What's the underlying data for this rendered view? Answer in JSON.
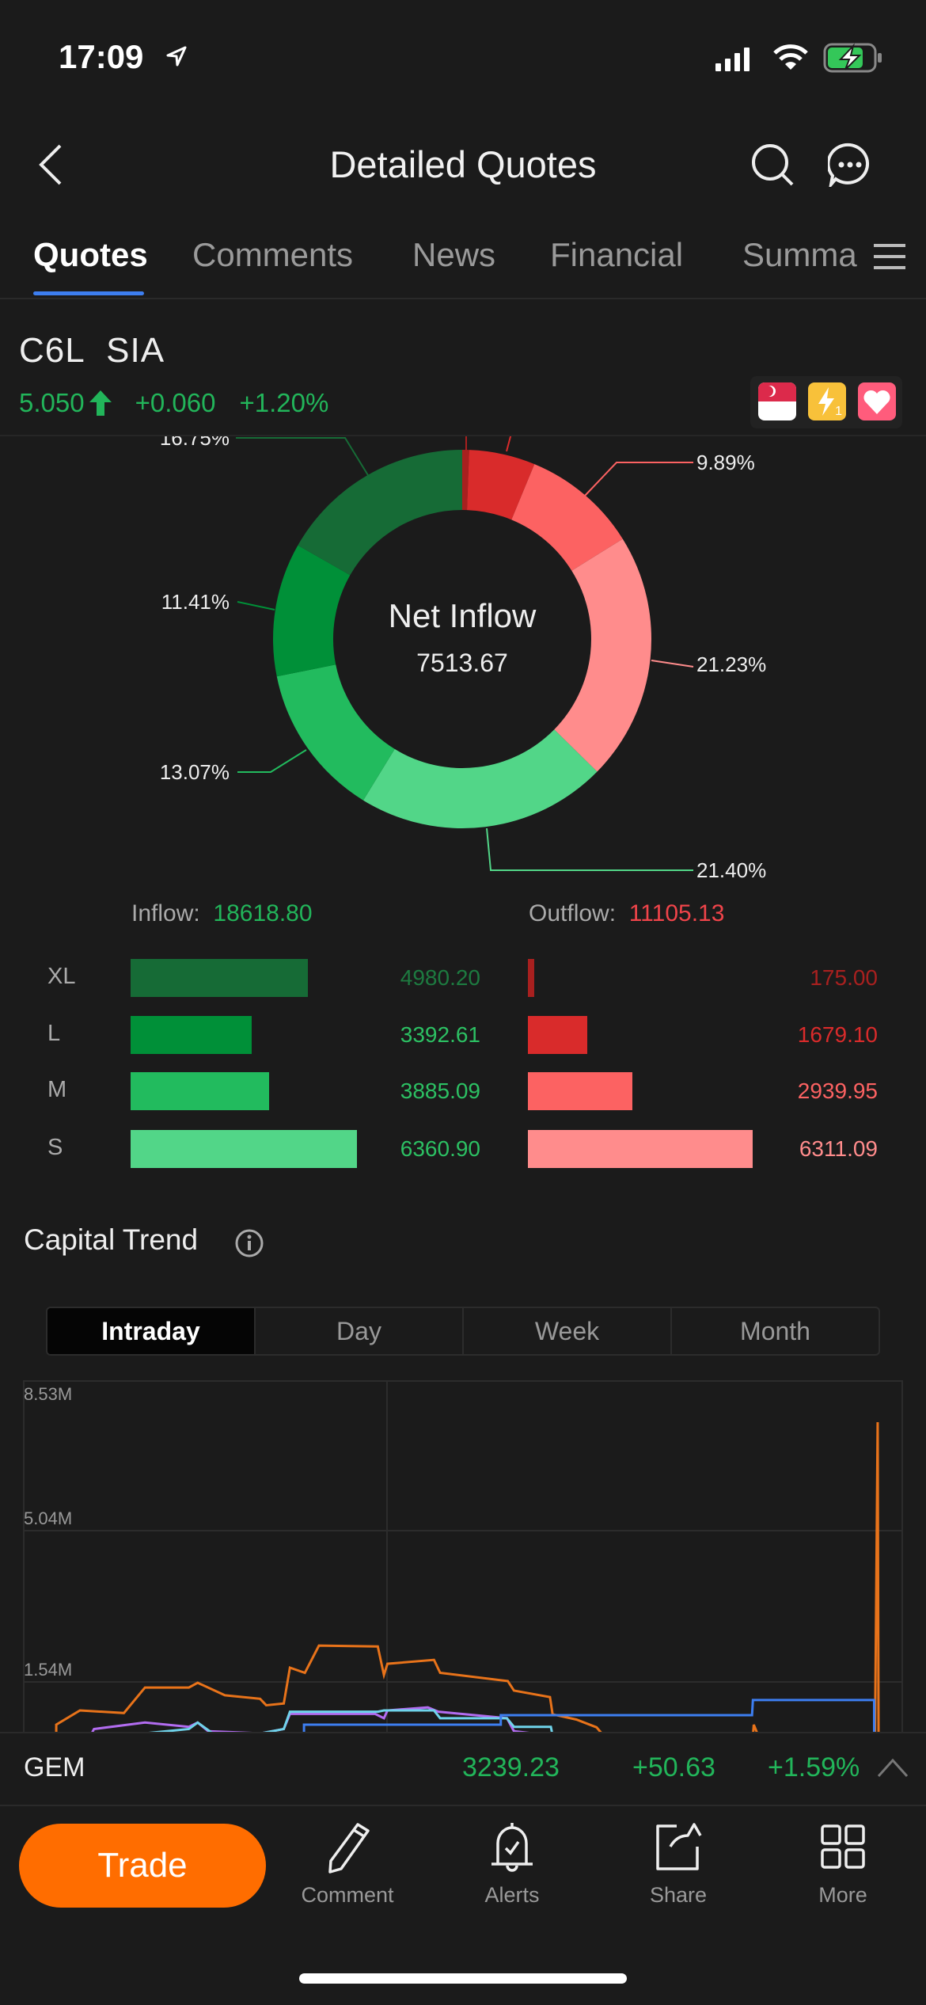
{
  "status_bar": {
    "time": "17:09",
    "battery_color": "#34c759"
  },
  "nav": {
    "title": "Detailed Quotes"
  },
  "tabs": [
    {
      "label": "Quotes",
      "active": true
    },
    {
      "label": "Comments"
    },
    {
      "label": "News"
    },
    {
      "label": "Financial"
    },
    {
      "label": "Summa"
    }
  ],
  "stock": {
    "symbol": "C6L",
    "name": "SIA",
    "price": "5.050",
    "change": "+0.060",
    "change_pct": "+1.20%",
    "badges": [
      "singapore-flag-icon",
      "lightning-icon",
      "heart-icon"
    ],
    "lightning_count": "1"
  },
  "donut": {
    "center_label": "Net Inflow",
    "center_value": "7513.67",
    "visible_labels": {
      "xl_in": "16.75%",
      "m_out": "9.89%",
      "s_out": "21.23%",
      "s_in": "21.40%",
      "m_in": "13.07%",
      "l_in": "11.41%"
    }
  },
  "flows": {
    "inflow_label": "Inflow:",
    "inflow_total": "18618.80",
    "outflow_label": "Outflow:",
    "outflow_total": "11105.13",
    "rows": [
      {
        "label": "XL",
        "inflow": "4980.20",
        "outflow": "175.00",
        "in_color": "#166b36",
        "out_color": "#a8201f"
      },
      {
        "label": "L",
        "inflow": "3392.61",
        "outflow": "1679.10",
        "in_color": "#009038",
        "out_color": "#d92b2b"
      },
      {
        "label": "M",
        "inflow": "3885.09",
        "outflow": "2939.95",
        "in_color": "#22bb5e",
        "out_color": "#fc6262"
      },
      {
        "label": "S",
        "inflow": "6360.90",
        "outflow": "6311.09",
        "in_color": "#52d688",
        "out_color": "#ff8c8c"
      }
    ]
  },
  "capital_trend": {
    "title": "Capital Trend",
    "periods": [
      {
        "label": "Intraday",
        "active": true
      },
      {
        "label": "Day"
      },
      {
        "label": "Week"
      },
      {
        "label": "Month"
      }
    ]
  },
  "chart_data": {
    "type": "line",
    "y_tick_labels": [
      "8.53M",
      "5.04M",
      "1.54M"
    ],
    "ylim": [
      0,
      8.53
    ],
    "grid": true,
    "x_unit": "percent of session elapsed",
    "series": [
      {
        "color": "#e8731a",
        "points": [
          [
            3.7,
            0.3
          ],
          [
            3.7,
            0.55
          ],
          [
            6.4,
            0.88
          ],
          [
            11.4,
            0.82
          ],
          [
            13.8,
            1.41
          ],
          [
            18.8,
            1.41
          ],
          [
            19.8,
            1.52
          ],
          [
            22.9,
            1.23
          ],
          [
            26.9,
            1.15
          ],
          [
            27.6,
            1.0
          ],
          [
            29.6,
            1.04
          ],
          [
            30.3,
            1.87
          ],
          [
            32,
            1.75
          ],
          [
            33.6,
            2.38
          ],
          [
            40.3,
            2.36
          ],
          [
            41,
            1.7
          ],
          [
            41.4,
            1.96
          ],
          [
            46.7,
            2.05
          ],
          [
            47.4,
            1.75
          ],
          [
            55.1,
            1.56
          ],
          [
            55.8,
            1.34
          ],
          [
            59.9,
            1.19
          ],
          [
            60.2,
            0.79
          ],
          [
            62.9,
            0.67
          ],
          [
            65.2,
            0.49
          ],
          [
            66,
            0.3
          ],
          [
            83,
            0.3
          ],
          [
            83.1,
            0.55
          ],
          [
            83.5,
            0.35
          ],
          [
            96.9,
            0.35
          ],
          [
            97.2,
            7.55
          ],
          [
            97.3,
            0.3
          ]
        ]
      },
      {
        "color": "#b26cf0",
        "points": [
          [
            7.6,
            0.3
          ],
          [
            8,
            0.45
          ],
          [
            13.8,
            0.6
          ],
          [
            18.8,
            0.5
          ],
          [
            19.8,
            0.6
          ],
          [
            21,
            0.4
          ],
          [
            27,
            0.35
          ],
          [
            29.6,
            0.45
          ],
          [
            30.3,
            0.8
          ],
          [
            40,
            0.8
          ],
          [
            41,
            0.7
          ],
          [
            41.4,
            0.88
          ],
          [
            46,
            0.95
          ],
          [
            47.2,
            0.85
          ],
          [
            55,
            0.7
          ],
          [
            55.8,
            0.4
          ],
          [
            60,
            0.3
          ]
        ]
      },
      {
        "color": "#6fd3ea",
        "points": [
          [
            13.8,
            0.35
          ],
          [
            18.8,
            0.45
          ],
          [
            19.8,
            0.6
          ],
          [
            21.5,
            0.35
          ],
          [
            27,
            0.35
          ],
          [
            29.6,
            0.45
          ],
          [
            30.3,
            0.85
          ],
          [
            40.3,
            0.85
          ],
          [
            41,
            0.88
          ],
          [
            46.7,
            0.88
          ],
          [
            47.4,
            0.7
          ],
          [
            55,
            0.7
          ],
          [
            55.8,
            0.5
          ],
          [
            60,
            0.5
          ],
          [
            60.2,
            0.3
          ],
          [
            62.5,
            0.35
          ],
          [
            65,
            0.3
          ]
        ]
      },
      {
        "color": "#3d7ef0",
        "points": [
          [
            31.9,
            0.3
          ],
          [
            31.9,
            0.55
          ],
          [
            54.3,
            0.55
          ],
          [
            54.3,
            0.77
          ],
          [
            82.9,
            0.77
          ],
          [
            83,
            1.12
          ],
          [
            96.8,
            1.12
          ],
          [
            96.8,
            0.3
          ]
        ]
      }
    ]
  },
  "index_bar": {
    "name": "GEM",
    "value": "3239.23",
    "change": "+50.63",
    "change_pct": "+1.59%"
  },
  "toolbar": {
    "trade": "Trade",
    "comment": "Comment",
    "alerts": "Alerts",
    "share": "Share",
    "more": "More",
    "accent": "#ff6d00"
  }
}
